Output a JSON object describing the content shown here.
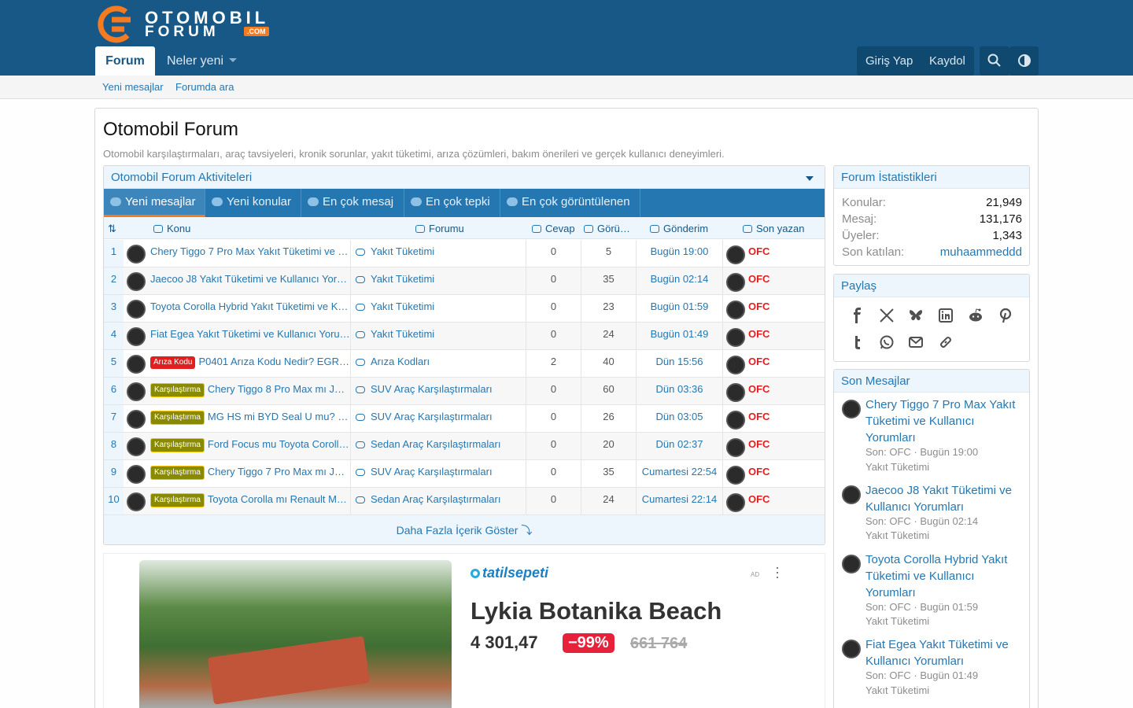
{
  "site": {
    "logo_line1": "OTOMOBIL",
    "logo_line2": "FORUM",
    "logo_com": ".COM"
  },
  "nav": {
    "tab_forum": "Forum",
    "tab_whats_new": "Neler yeni",
    "login": "Giriş Yap",
    "register": "Kaydol"
  },
  "subnav": {
    "new_posts": "Yeni mesajlar",
    "search_forums": "Forumda ara"
  },
  "page": {
    "title": "Otomobil Forum",
    "description": "Otomobil karşılaştırmaları, araç tavsiyeleri, kronik sorunlar, yakıt tüketimi, arıza çözümleri, bakım önerileri ve gerçek kullanıcı deneyimleri."
  },
  "activity": {
    "title": "Otomobil Forum Aktiviteleri",
    "tabs": [
      "Yeni mesajlar",
      "Yeni konular",
      "En çok mesaj",
      "En çok tepki",
      "En çok görüntülenen"
    ],
    "columns": {
      "topic": "Konu",
      "forum": "Forumu",
      "replies": "Cevap",
      "views": "Görü…",
      "posted": "Gönderim",
      "last_poster": "Son yazan"
    },
    "rows": [
      {
        "n": "1",
        "badge": "",
        "topic": "Chery Tiggo 7 Pro Max Yakıt Tüketimi ve …",
        "forum": "Yakıt Tüketimi",
        "replies": "0",
        "views": "5",
        "date": "Bugün 19:00",
        "last": "OFC"
      },
      {
        "n": "2",
        "badge": "",
        "topic": "Jaecoo J8 Yakıt Tüketimi ve Kullanıcı Yor…",
        "forum": "Yakıt Tüketimi",
        "replies": "0",
        "views": "35",
        "date": "Bugün 02:14",
        "last": "OFC"
      },
      {
        "n": "3",
        "badge": "",
        "topic": "Toyota Corolla Hybrid Yakıt Tüketimi ve K…",
        "forum": "Yakıt Tüketimi",
        "replies": "0",
        "views": "23",
        "date": "Bugün 01:59",
        "last": "OFC"
      },
      {
        "n": "4",
        "badge": "",
        "topic": "Fiat Egea Yakıt Tüketimi ve Kullanıcı Yoru…",
        "forum": "Yakıt Tüketimi",
        "replies": "0",
        "views": "24",
        "date": "Bugün 01:49",
        "last": "OFC"
      },
      {
        "n": "5",
        "badge": "Arıza Kodu",
        "topic": "P0401 Arıza Kodu Nedir? EGR…",
        "forum": "Arıza Kodları",
        "replies": "2",
        "views": "40",
        "date": "Dün 15:56",
        "last": "OFC"
      },
      {
        "n": "6",
        "badge": "Karşılaştırma",
        "topic": "Chery Tiggo 8 Pro Max mı Ja…",
        "forum": "SUV Araç Karşılaştırmaları",
        "replies": "0",
        "views": "60",
        "date": "Dün 03:36",
        "last": "OFC"
      },
      {
        "n": "7",
        "badge": "Karşılaştırma",
        "topic": "MG HS mi BYD Seal U mu? …",
        "forum": "SUV Araç Karşılaştırmaları",
        "replies": "0",
        "views": "26",
        "date": "Dün 03:05",
        "last": "OFC"
      },
      {
        "n": "8",
        "badge": "Karşılaştırma",
        "topic": "Ford Focus mu Toyota Coroll…",
        "forum": "Sedan Araç Karşılaştırmaları",
        "replies": "0",
        "views": "20",
        "date": "Dün 02:37",
        "last": "OFC"
      },
      {
        "n": "9",
        "badge": "Karşılaştırma",
        "topic": "Chery Tiggo 7 Pro Max mı Ja…",
        "forum": "SUV Araç Karşılaştırmaları",
        "replies": "0",
        "views": "35",
        "date": "Cumartesi 22:54",
        "last": "OFC"
      },
      {
        "n": "10",
        "badge": "Karşılaştırma",
        "topic": "Toyota Corolla mı Renault M…",
        "forum": "Sedan Araç Karşılaştırmaları",
        "replies": "0",
        "views": "24",
        "date": "Cumartesi 22:14",
        "last": "OFC"
      }
    ],
    "more_label": "Daha Fazla İçerik Göster ⤵"
  },
  "ad": {
    "brand": "tatilsepeti",
    "tag": "AD",
    "title": "Lykia Botanika Beach",
    "price": "4 301,47",
    "discount": "−99%",
    "old_price": "661 764"
  },
  "stats": {
    "title": "Forum İstatistikleri",
    "items": [
      {
        "label": "Konular:",
        "value": "21,949"
      },
      {
        "label": "Mesaj:",
        "value": "131,176"
      },
      {
        "label": "Üyeler:",
        "value": "1,343"
      },
      {
        "label": "Son katılan:",
        "value": "muhaammeddd"
      }
    ]
  },
  "share": {
    "title": "Paylaş"
  },
  "recent": {
    "title": "Son Mesajlar",
    "items": [
      {
        "title": "Chery Tiggo 7 Pro Max Yakıt Tüketimi ve Kullanıcı Yorumları",
        "meta": "Son: OFC · Bugün 19:00",
        "forum": "Yakıt Tüketimi"
      },
      {
        "title": "Jaecoo J8 Yakıt Tüketimi ve Kullanıcı Yorumları",
        "meta": "Son: OFC · Bugün 02:14",
        "forum": "Yakıt Tüketimi"
      },
      {
        "title": "Toyota Corolla Hybrid Yakıt Tüketimi ve Kullanıcı Yorumları",
        "meta": "Son: OFC · Bugün 01:59",
        "forum": "Yakıt Tüketimi"
      },
      {
        "title": "Fiat Egea Yakıt Tüketimi ve Kullanıcı Yorumları",
        "meta": "Son: OFC · Bugün 01:49",
        "forum": "Yakıt Tüketimi"
      }
    ]
  },
  "colors": {
    "header": "#185886",
    "accent": "#2577b1",
    "highlight": "#f47b20",
    "last_poster": "#e02020"
  }
}
